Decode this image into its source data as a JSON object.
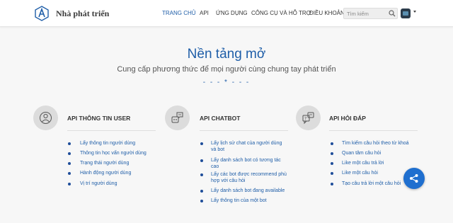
{
  "header": {
    "brand": "Nhà phát triển",
    "nav": [
      "TRANG CHỦ",
      "API",
      "ỨNG DỤNG",
      "CÔNG CỤ VÀ HỖ TRỢ",
      "ĐIỀU KHOẢN"
    ],
    "active_nav": "TRANG CHỦ",
    "search_placeholder": "Tìm kiếm"
  },
  "hero": {
    "title": "Nền tảng mở",
    "subtitle": "Cung cấp phương thức để mọi người cùng chung tay phát triển",
    "divider": "- - - * - - -"
  },
  "columns": [
    {
      "icon": "user-profile-icon",
      "title": "API THÔNG TIN USER",
      "items": [
        "Lấy thông tin người dùng",
        "Thông tin học vấn người dùng",
        "Trạng thái người dùng",
        "Hành động người dùng",
        "Vị trí người dùng"
      ]
    },
    {
      "icon": "chatbot-icon",
      "title": "API CHATBOT",
      "items": [
        "Lấy lịch sử chat của người dùng và bot",
        "Lấy danh sách bot có tương tác cao",
        "Lấy các bot được recommend phù hợp với câu hỏi",
        "Lấy danh sách bot đang available",
        "Lấy thông tin của một bot"
      ]
    },
    {
      "icon": "qa-icon",
      "title": "API HỎI ĐÁP",
      "items": [
        "Tìm kiếm câu hỏi theo từ khoá",
        "Quan tâm câu hỏi",
        "Like một câu trả lời",
        "Like một câu hỏi",
        "Tạo câu trả lời một câu hỏi"
      ]
    }
  ],
  "colors": {
    "accent": "#1f5ea8",
    "share_button": "#1f6fcf"
  }
}
